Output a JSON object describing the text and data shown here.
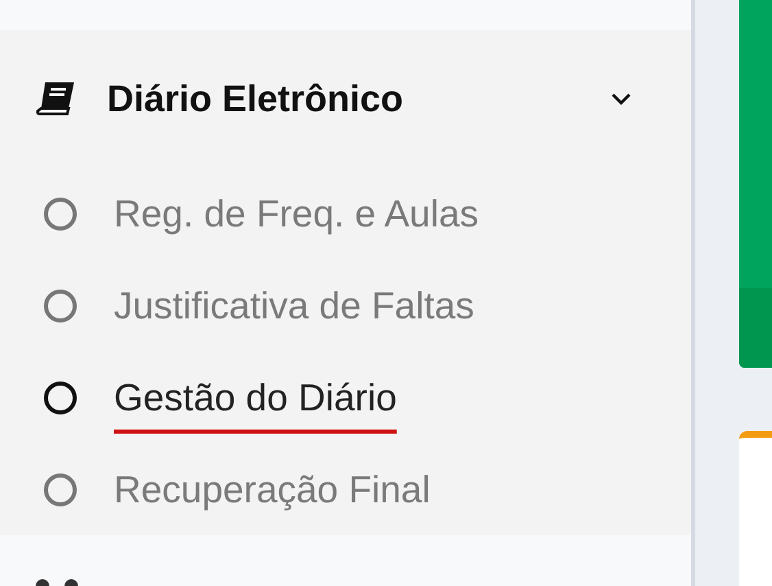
{
  "menu": {
    "title": "Diário Eletrônico",
    "expanded": true,
    "items": [
      {
        "label": "Reg. de Freq. e Aulas",
        "selected": false
      },
      {
        "label": "Justificativa de Faltas",
        "selected": false
      },
      {
        "label": "Gestão do Diário",
        "selected": true
      },
      {
        "label": "Recuperação Final",
        "selected": false
      }
    ]
  }
}
